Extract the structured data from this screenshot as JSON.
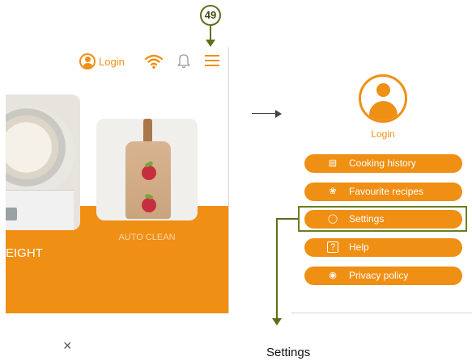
{
  "step_marker": {
    "number": "49"
  },
  "app_screen": {
    "top_bar": {
      "login_label": "Login",
      "wifi_icon": "wifi-icon",
      "bell_icon": "bell-icon",
      "menu_icon": "hamburger-menu-icon"
    },
    "cards": [
      {
        "label": "EIGHT"
      },
      {
        "label": "AUTO CLEAN"
      }
    ]
  },
  "menu_panel": {
    "login_label": "Login",
    "items": [
      {
        "label": "Cooking history",
        "icon": "history-icon"
      },
      {
        "label": "Favourite recipes",
        "icon": "recipe-icon"
      },
      {
        "label": "Settings",
        "icon": "settings-icon"
      },
      {
        "label": "Help",
        "icon": "help-icon"
      },
      {
        "label": "Privacy policy",
        "icon": "shield-icon"
      }
    ]
  },
  "footer": {
    "close_symbol": "×",
    "result_title": "Settings"
  },
  "colors": {
    "accent": "#ef8f14",
    "annotation": "#5d6f1c"
  }
}
